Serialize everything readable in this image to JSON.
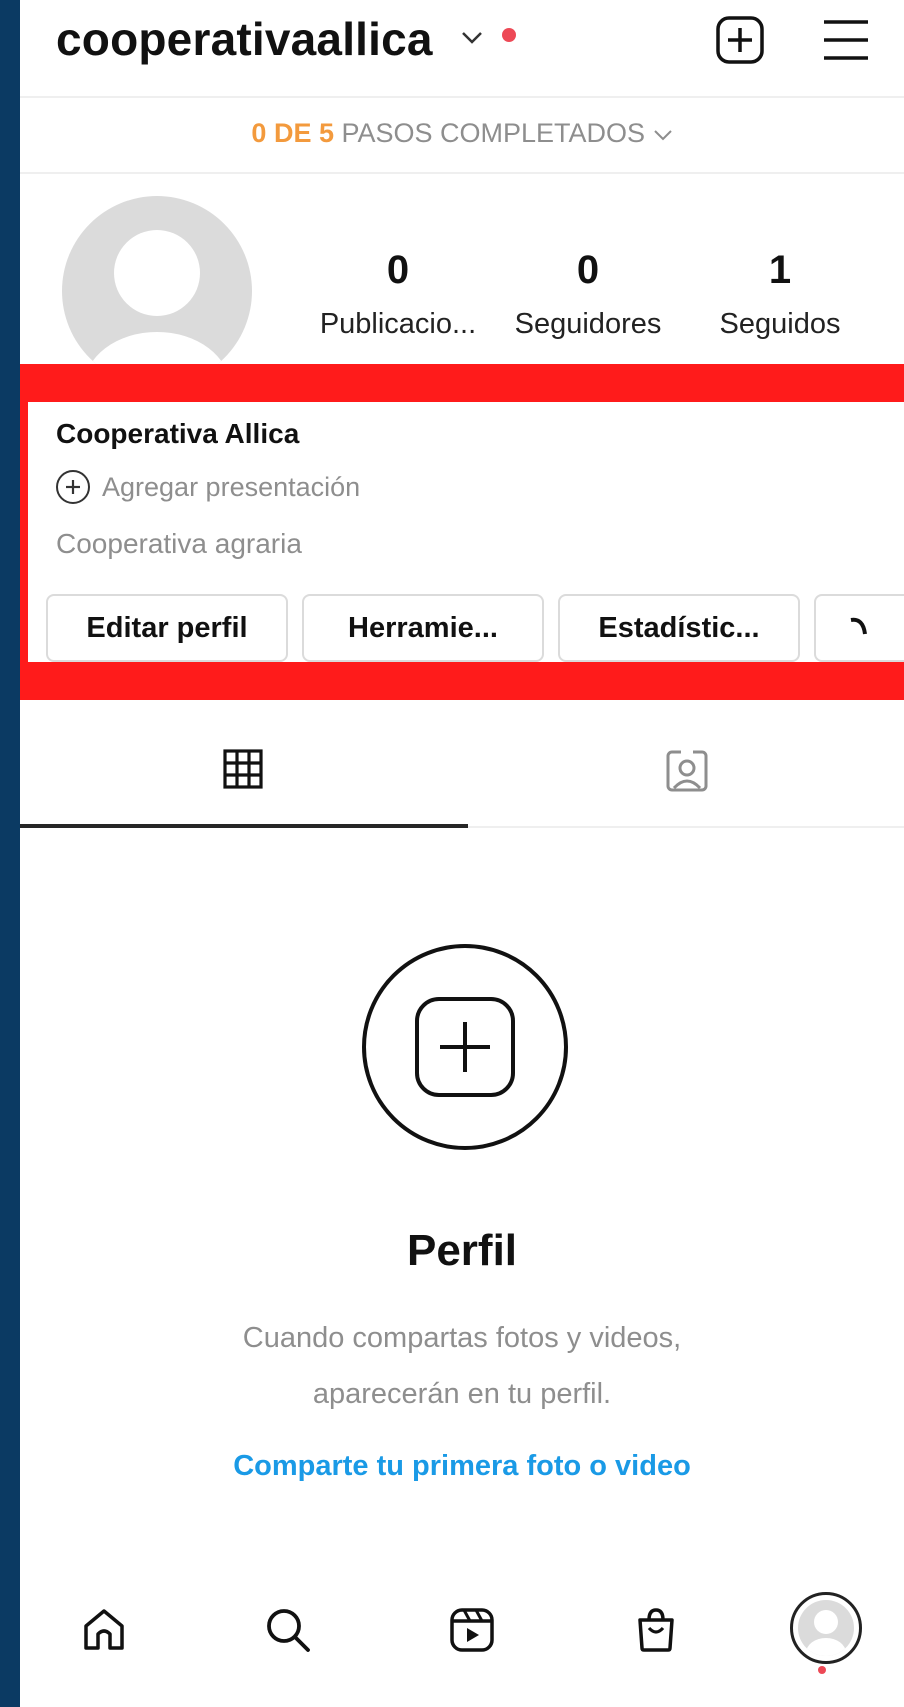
{
  "header": {
    "username": "cooperativaallica"
  },
  "steps": {
    "highlight": "0 DE 5",
    "rest": "PASOS COMPLETADOS"
  },
  "stats": [
    {
      "value": "0",
      "label": "Publicacio..."
    },
    {
      "value": "0",
      "label": "Seguidores"
    },
    {
      "value": "1",
      "label": "Seguidos"
    }
  ],
  "profile": {
    "name": "Cooperativa Allica",
    "add_bio": "Agregar presentación",
    "category": "Cooperativa agraria"
  },
  "buttons": {
    "edit": "Editar perfil",
    "tools": "Herramie...",
    "insights": "Estadístic..."
  },
  "empty_state": {
    "title": "Perfil",
    "desc_line1": "Cuando compartas fotos y videos,",
    "desc_line2": "aparecerán en tu perfil.",
    "link": "Comparte tu primera foto o video"
  },
  "colors": {
    "accent_orange": "#f39a3d",
    "link_blue": "#1a9ae6",
    "highlight_red": "#ff1b1b",
    "notification_red": "#ed4956"
  },
  "icons": [
    "chevron-down-icon",
    "new-post-icon",
    "menu-icon",
    "grid-icon",
    "tagged-icon",
    "home-icon",
    "search-icon",
    "reels-icon",
    "shop-icon",
    "plus-icon"
  ]
}
